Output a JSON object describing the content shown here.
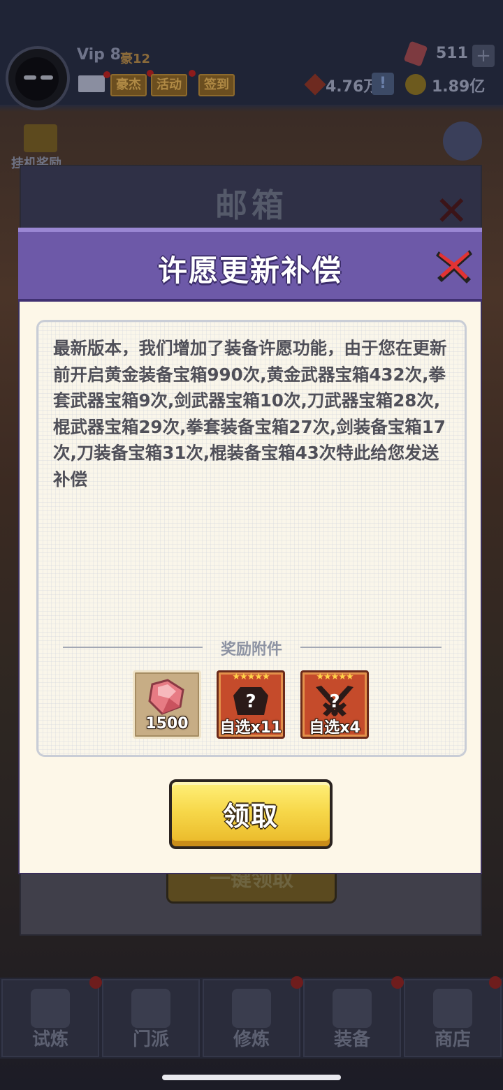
{
  "top_bar": {
    "vip": "Vip 8",
    "vip_sub": "豪12",
    "tags": [
      "豪杰",
      "活动",
      "签到"
    ],
    "gems": "511",
    "seal_value": "4.76万",
    "coins": "1.89亿",
    "idle_label": "挂机奖励"
  },
  "mailbox": {
    "title": "邮箱",
    "behind_button": "一键领取"
  },
  "dialog": {
    "title": "许愿更新补偿",
    "message": "最新版本，我们增加了装备许愿功能，由于您在更新前开启黄金装备宝箱990次,黄金武器宝箱432次,拳套武器宝箱9次,剑武器宝箱10次,刀武器宝箱28次,棍武器宝箱29次,拳套装备宝箱27次,剑装备宝箱17次,刀装备宝箱31次,棍装备宝箱43次特此给您发送补偿",
    "reward_label": "奖励附件",
    "rewards": [
      {
        "icon": "gem-icon",
        "count": "1500"
      },
      {
        "icon": "mystery-armor-icon",
        "stars": "★★★★★",
        "count": "自选x11"
      },
      {
        "icon": "mystery-weapon-icon",
        "stars": "★★★★★",
        "count": "自选x4"
      }
    ],
    "claim_label": "领取"
  },
  "bottom_nav": [
    {
      "label": "试炼",
      "icon": "ninja-icon"
    },
    {
      "label": "门派",
      "icon": "temple-icon"
    },
    {
      "label": "修炼",
      "icon": "scroll-icon"
    },
    {
      "label": "装备",
      "icon": "sword-icon"
    },
    {
      "label": "商店",
      "icon": "shop-icon"
    }
  ],
  "colors": {
    "header_purple": "#6d59a8",
    "claim_yellow": "#f7d84a",
    "reward_red": "#c54b2b"
  }
}
